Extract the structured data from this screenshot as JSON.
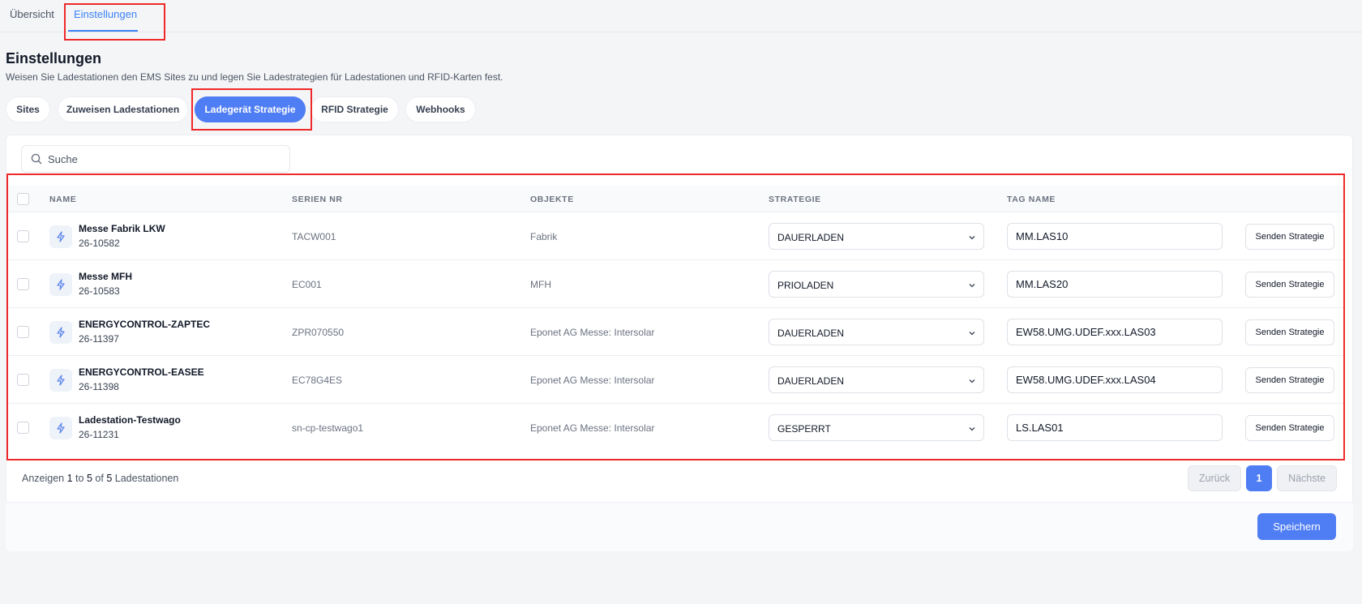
{
  "top_tabs": [
    "Übersicht",
    "Einstellungen"
  ],
  "page": {
    "title": "Einstellungen",
    "subtitle": "Weisen Sie Ladestationen den EMS Sites zu und legen Sie Ladestrategien für Ladestationen und RFID-Karten fest."
  },
  "sub_tabs": [
    "Sites",
    "Zuweisen Ladestationen",
    "Ladegerät Strategie",
    "RFID Strategie",
    "Webhooks"
  ],
  "active_sub_tab": "Ladegerät Strategie",
  "search": {
    "placeholder": "Suche",
    "value": ""
  },
  "table": {
    "columns": [
      "NAME",
      "SERIEN NR",
      "OBJEKTE",
      "STRATEGIE",
      "TAG NAME"
    ],
    "rows": [
      {
        "name": "Messe Fabrik LKW",
        "code": "26-10582",
        "serial": "TACW001",
        "object": "Fabrik",
        "strategy": "DAUERLADEN",
        "tag": "MM.LAS10",
        "action": "Senden Strategie"
      },
      {
        "name": "Messe MFH",
        "code": "26-10583",
        "serial": "EC001",
        "object": "MFH",
        "strategy": "PRIOLADEN",
        "tag": "MM.LAS20",
        "action": "Senden Strategie"
      },
      {
        "name": "ENERGYCONTROL-ZAPTEC",
        "code": "26-11397",
        "serial": "ZPR070550",
        "object": "Eponet AG Messe: Intersolar",
        "strategy": "DAUERLADEN",
        "tag": "EW58.UMG.UDEF.xxx.LAS03",
        "action": "Senden Strategie"
      },
      {
        "name": "ENERGYCONTROL-EASEE",
        "code": "26-11398",
        "serial": "EC78G4ES",
        "object": "Eponet AG Messe: Intersolar",
        "strategy": "DAUERLADEN",
        "tag": "EW58.UMG.UDEF.xxx.LAS04",
        "action": "Senden Strategie"
      },
      {
        "name": "Ladestation-Testwago",
        "code": "26-11231",
        "serial": "sn-cp-testwago1",
        "object": "Eponet AG Messe: Intersolar",
        "strategy": "GESPERRT",
        "tag": "LS.LAS01",
        "action": "Senden Strategie"
      }
    ]
  },
  "pagination": {
    "prefix": "Anzeigen",
    "from": "1",
    "to_word": "to",
    "to": "5",
    "of_word": "of",
    "total": "5",
    "suffix": "Ladestationen",
    "prev": "Zurück",
    "page": "1",
    "next": "Nächste"
  },
  "save_label": "Speichern",
  "colors": {
    "accent": "#4f7df3",
    "highlight": "#ef2929"
  },
  "icons": {
    "search": "search-icon",
    "row": "lightning-icon",
    "select": "chevron-down-icon"
  }
}
